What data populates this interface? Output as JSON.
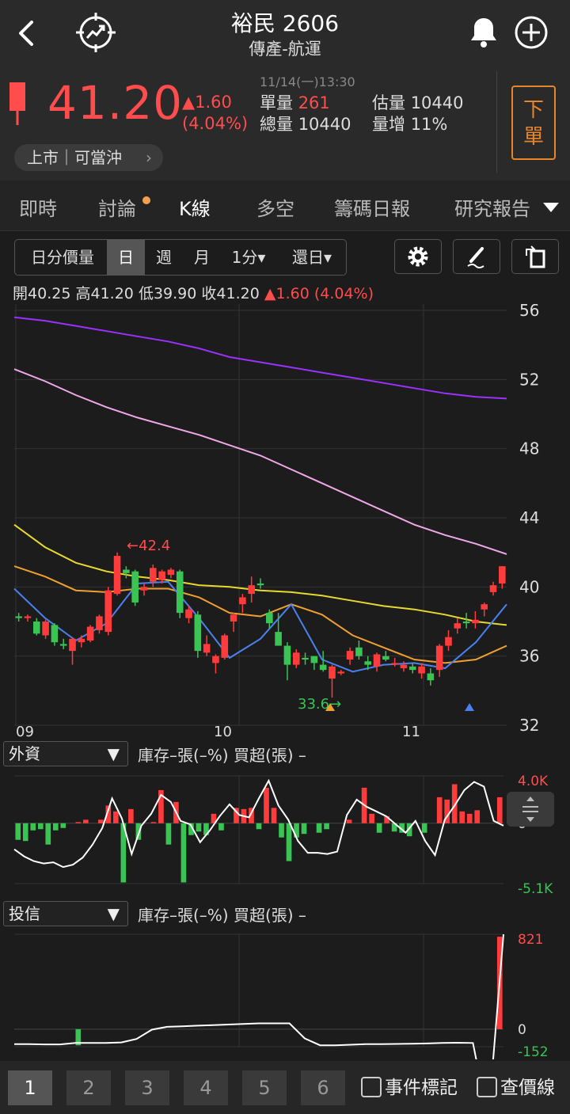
{
  "header": {
    "title": "裕民 2606",
    "subtitle": "傳產-航運",
    "back_icon": "back-arrow-icon",
    "logo_icon": "trend-target-icon"
  },
  "quote": {
    "price": "41.20",
    "change": "▲1.60",
    "change_pct": "(4.04%)",
    "timestamp": "11/14(一)13:30",
    "unit_volume_label": "單量",
    "unit_volume": "261",
    "total_volume_label": "總量",
    "total_volume": "10440",
    "est_volume_label": "估量",
    "est_volume": "10440",
    "volume_increase_label": "量增",
    "volume_increase": "11%",
    "order_button": "下\n單",
    "market_pill": "上市｜可當沖"
  },
  "tabs": [
    "即時",
    "討論",
    "K線",
    "多空",
    "籌碼日報",
    "研究報告"
  ],
  "toolbar": {
    "items": [
      "日分價量",
      "日",
      "週",
      "月",
      "1分▾",
      "還日▾"
    ]
  },
  "ohlc": {
    "open_label": "開",
    "open": "40.25",
    "high_label": "高",
    "high": "41.20",
    "low_label": "低",
    "low": "39.90",
    "close_label": "收",
    "close": "41.20",
    "change": "▲1.60 (4.04%)"
  },
  "chart_data": [
    {
      "type": "candlestick",
      "y_ticks": [
        "56",
        "52",
        "48",
        "44",
        "40",
        "36",
        "32"
      ],
      "ylim": [
        32,
        56
      ],
      "x_ticks": [
        "09",
        "10",
        "11"
      ],
      "annotations": [
        "←42.4",
        "33.6→"
      ],
      "candles": [
        [
          38.3,
          38.5,
          38.0,
          38.2
        ],
        [
          38.2,
          38.4,
          38.0,
          38.3
        ],
        [
          38.0,
          38.2,
          37.2,
          37.3
        ],
        [
          37.2,
          38.1,
          37.0,
          38.0
        ],
        [
          37.8,
          37.9,
          36.6,
          36.8
        ],
        [
          36.7,
          37.0,
          36.4,
          36.6
        ],
        [
          36.3,
          37.1,
          35.5,
          37.0
        ],
        [
          36.8,
          37.2,
          36.5,
          37.0
        ],
        [
          36.9,
          37.8,
          36.8,
          37.7
        ],
        [
          37.5,
          38.4,
          37.3,
          38.3
        ],
        [
          37.4,
          40.0,
          37.2,
          39.8
        ],
        [
          39.6,
          42.0,
          39.5,
          41.8
        ],
        [
          41.0,
          41.2,
          40.5,
          40.8
        ],
        [
          40.9,
          41.0,
          38.9,
          39.1
        ],
        [
          39.8,
          40.2,
          39.5,
          40.0
        ],
        [
          40.3,
          41.3,
          40.0,
          41.1
        ],
        [
          40.4,
          41.0,
          40.2,
          40.9
        ],
        [
          40.7,
          41.1,
          40.5,
          41.0
        ],
        [
          40.9,
          41.0,
          38.2,
          38.5
        ],
        [
          38.2,
          38.9,
          37.9,
          38.7
        ],
        [
          38.4,
          38.6,
          35.9,
          36.3
        ],
        [
          36.2,
          37.2,
          36.0,
          36.7
        ],
        [
          35.6,
          36.1,
          35.0,
          36.0
        ],
        [
          35.9,
          37.3,
          35.8,
          37.2
        ],
        [
          38.0,
          38.5,
          37.4,
          38.4
        ],
        [
          39.0,
          39.6,
          38.5,
          39.4
        ],
        [
          39.6,
          40.6,
          39.1,
          40.1
        ],
        [
          40.2,
          40.5,
          39.9,
          40.1
        ],
        [
          38.5,
          38.7,
          37.6,
          37.9
        ],
        [
          37.4,
          38.5,
          37.0,
          36.6
        ],
        [
          36.6,
          36.8,
          34.6,
          35.5
        ],
        [
          35.5,
          36.4,
          35.3,
          36.2
        ],
        [
          35.9,
          36.2,
          35.5,
          35.8
        ],
        [
          36.0,
          36.0,
          35.2,
          35.6
        ],
        [
          35.5,
          36.3,
          35.1,
          35.2
        ],
        [
          34.7,
          35.5,
          33.6,
          35.4
        ],
        [
          35.0,
          35.2,
          34.9,
          35.1
        ],
        [
          35.8,
          36.5,
          35.5,
          36.3
        ],
        [
          36.5,
          36.9,
          35.8,
          36.0
        ],
        [
          35.7,
          36.0,
          35.2,
          35.5
        ],
        [
          35.4,
          36.2,
          35.1,
          36.1
        ],
        [
          36.0,
          36.3,
          35.7,
          35.8
        ],
        [
          35.6,
          35.9,
          35.4,
          35.6
        ],
        [
          35.3,
          35.7,
          35.1,
          35.5
        ],
        [
          35.4,
          35.6,
          35.0,
          35.2
        ],
        [
          35.0,
          35.6,
          34.7,
          35.4
        ],
        [
          35.0,
          35.3,
          34.3,
          34.6
        ],
        [
          35.2,
          36.7,
          34.8,
          36.6
        ],
        [
          36.6,
          37.5,
          36.3,
          37.1
        ],
        [
          37.6,
          38.2,
          37.3,
          37.9
        ],
        [
          38.0,
          38.5,
          37.6,
          37.9
        ],
        [
          37.9,
          38.6,
          37.6,
          38.1
        ],
        [
          38.7,
          39.1,
          38.3,
          39.0
        ],
        [
          39.7,
          40.3,
          39.5,
          40.1
        ],
        [
          40.2,
          41.2,
          39.9,
          41.2
        ]
      ],
      "series": [
        {
          "name": "",
          "color": "#9b30ff",
          "values": [
            55.6,
            55.4,
            55.1,
            54.8,
            54.5,
            54.2,
            53.8,
            53.3,
            53.0,
            52.7,
            52.4,
            52.1,
            51.8,
            51.5,
            51.2,
            51.0,
            50.9
          ]
        },
        {
          "name": "",
          "color": "#f0a8e8",
          "values": [
            52.6,
            51.9,
            51.1,
            50.4,
            49.8,
            49.3,
            48.8,
            48.2,
            47.6,
            46.8,
            46.0,
            45.2,
            44.4,
            43.6,
            43.0,
            42.5,
            41.9
          ]
        },
        {
          "name": "",
          "color": "#e8d830",
          "values": [
            43.6,
            42.3,
            41.4,
            40.9,
            40.6,
            40.4,
            40.1,
            40.0,
            39.8,
            39.7,
            39.5,
            39.2,
            38.9,
            38.7,
            38.4,
            38.0,
            37.8
          ]
        },
        {
          "name": "",
          "color": "#f0a030",
          "values": [
            41.2,
            40.6,
            39.8,
            39.7,
            39.9,
            39.9,
            39.4,
            38.5,
            38.3,
            39.0,
            38.4,
            37.2,
            36.5,
            35.8,
            35.6,
            35.8,
            36.6
          ]
        },
        {
          "name": "",
          "color": "#4a80f0",
          "values": [
            39.9,
            38.2,
            36.9,
            37.9,
            40.2,
            40.3,
            38.2,
            35.9,
            37.0,
            39.0,
            35.8,
            35.1,
            35.5,
            35.6,
            35.3,
            36.8,
            39.0
          ]
        }
      ]
    },
    {
      "type": "bar",
      "selector": "外資",
      "legend": "庫存–張(–%)  買超(張) –",
      "y_ticks": [
        "4.0K",
        "0",
        "-5.1K"
      ],
      "ylim": [
        -5.1,
        4.0
      ],
      "values": [
        -1.4,
        -1.5,
        -0.6,
        -0.5,
        -1.8,
        -0.6,
        -0.4,
        0,
        0.1,
        0.3,
        0,
        0.3,
        1.5,
        1.0,
        -5.0,
        1.2,
        -1.4,
        0,
        0.1,
        2.8,
        -1.8,
        1.8,
        -5.0,
        -1.0,
        -0.7,
        -1.0,
        0.8,
        -0.6,
        0,
        1.3,
        1.2,
        1.3,
        -0.5,
        3.0,
        1.3,
        -1.2,
        -3.2,
        -1.2,
        -0.9,
        0,
        -0.8,
        -0.5,
        0,
        0,
        0.3,
        0,
        3.0,
        0.8,
        -0.8,
        0.6,
        -0.7,
        -0.8,
        -1.1,
        0,
        -0.8,
        0,
        2.2,
        2.0,
        3.3,
        1.0,
        0.8,
        1.1,
        0,
        0,
        2.2
      ],
      "line": [
        -2.2,
        -2.8,
        -3.2,
        -3.4,
        -3.3,
        -3.7,
        -3.5,
        -2.9,
        -1.8,
        -0.4,
        2.1,
        0.4,
        -2.6,
        -0.2,
        0.8,
        2.4,
        1.8,
        0.2,
        -0.1,
        -1.6,
        -0.6,
        0.6,
        1.6,
        0.7,
        0.5,
        2.1,
        3.6,
        1.5,
        0.3,
        -1.5,
        -2.5,
        -2.5,
        -2.6,
        -2.4,
        0.7,
        2.0,
        1.4,
        1.0,
        0.6,
        -0.1,
        -0.8,
        0.2,
        -1.5,
        -2.7,
        0.3,
        1.5,
        2.8,
        3.5,
        3.1,
        0.2,
        -0.2
      ]
    },
    {
      "type": "bar",
      "selector": "投信",
      "legend": "庫存–張(–%)  買超(張) –",
      "y_ticks": [
        "821",
        "0",
        "-152"
      ],
      "ylim": [
        -152,
        821
      ],
      "values": [
        0,
        0,
        0,
        0,
        0,
        0,
        0,
        0,
        -140,
        0,
        0,
        0,
        0,
        0,
        0,
        0,
        0,
        0,
        0,
        0,
        0,
        0,
        0,
        0,
        0,
        0,
        0,
        0,
        0,
        0,
        0,
        0,
        0,
        0,
        0,
        0,
        0,
        0,
        0,
        0,
        0,
        0,
        0,
        0,
        0,
        0,
        0,
        0,
        0,
        0,
        0,
        0,
        0,
        0,
        0,
        0,
        0,
        0,
        0,
        0,
        0,
        0,
        0,
        0,
        800
      ],
      "line": [
        -130,
        -130,
        -132,
        -132,
        -120,
        -120,
        -120,
        -115,
        -85,
        -5,
        20,
        25,
        30,
        35,
        40,
        45,
        50,
        50,
        50,
        -80,
        -140,
        -140,
        -135,
        -130,
        -130,
        -128,
        -126,
        -124,
        -120,
        -118,
        -120,
        -780,
        820
      ]
    }
  ],
  "sub1": {
    "selector": "外資",
    "legend": "庫存–張(–%)  買超(張) –",
    "ymax": "4.0K",
    "yzero": "0",
    "ymin": "-5.1K"
  },
  "sub2": {
    "selector": "投信",
    "legend": "庫存–張(–%)  買超(張) –",
    "ymax": "821",
    "yzero": "0",
    "ymin": "-152"
  },
  "footer": {
    "pages": [
      "1",
      "2",
      "3",
      "4",
      "5",
      "6"
    ],
    "event_mark": "事件標記",
    "price_lookup": "查價線"
  }
}
